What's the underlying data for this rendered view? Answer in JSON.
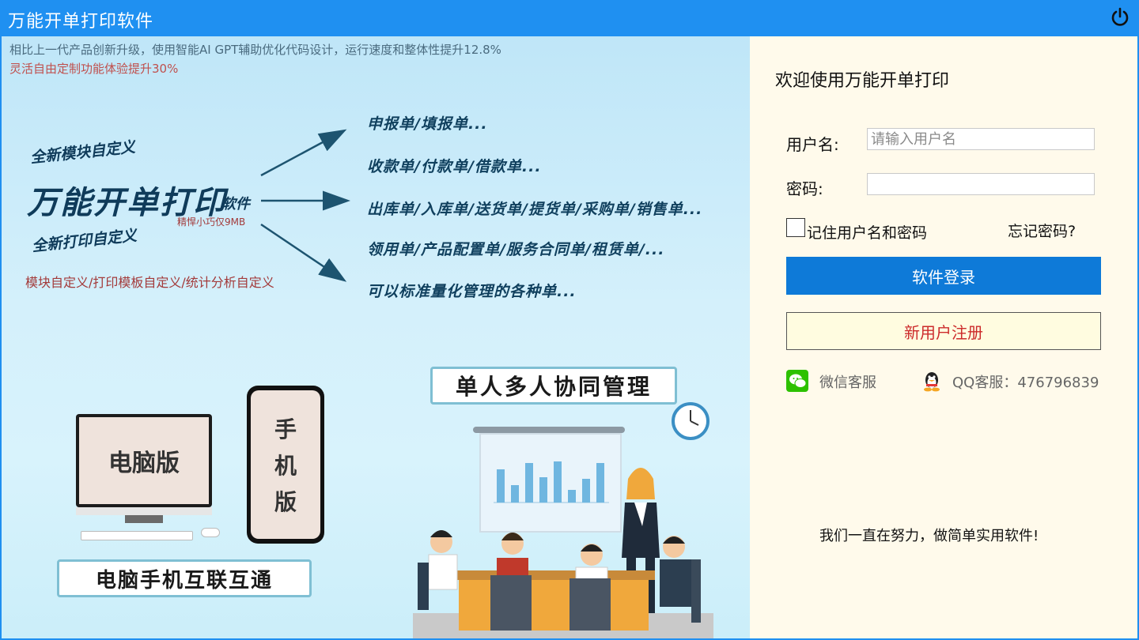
{
  "window": {
    "title": "万能开单打印软件"
  },
  "banner": {
    "line1": "相比上一代产品创新升级，使用智能AI GPT辅助优化代码设计，运行速度和整体性提升12.8%",
    "line2": "灵活自由定制功能体验提升30%",
    "new_module": "全新模块自定义",
    "main_title": "万能开单打印",
    "main_suffix": "软件",
    "size_note": "精悍小巧仅9MB",
    "new_print": "全新打印自定义",
    "custom_note": "模块自定义/打印模板自定义/统计分析自定义",
    "list": [
      "申报单/填报单...",
      "收款单/付款单/借款单...",
      "出库单/入库单/送货单/提货单/采购单/销售单...",
      "领用单/产品配置单/服务合同单/租赁单/...",
      "可以标准量化管理的各种单..."
    ],
    "pc_label": "电脑版",
    "phone_label": [
      "手",
      "机",
      "版"
    ],
    "interconnect": "电脑手机互联互通",
    "collab": "单人多人协同管理"
  },
  "login": {
    "welcome": "欢迎使用万能开单打印",
    "username_label": "用户名:",
    "username_placeholder": "请输入用户名",
    "password_label": "密码:",
    "remember_label": "记住用户名和密码",
    "forgot_label": "忘记密码?",
    "login_button": "软件登录",
    "register_button": "新用户注册",
    "wechat_label": "微信客服",
    "qq_label": "QQ客服：476796839",
    "footer": "我们一直在努力，做简单实用软件!"
  }
}
